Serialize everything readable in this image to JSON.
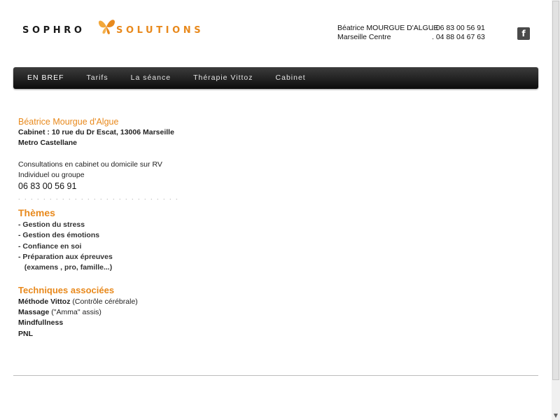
{
  "logo": {
    "left_word": "SOPHRO",
    "right_word": "SOLUTIONS",
    "accent_color": "#e8891c"
  },
  "contact": {
    "row1_name": "Béatrice MOURGUE D'ALGUE",
    "row1_phone": ".  06 83 00 56 91",
    "row2_name": "Marseille  Centre",
    "row2_phone": ".  04 88 04 67 63"
  },
  "social": {
    "facebook_icon": "facebook-icon",
    "facebook_glyph": "f"
  },
  "nav": {
    "items": [
      {
        "label": "EN BREF"
      },
      {
        "label": "Tarifs"
      },
      {
        "label": "La séance"
      },
      {
        "label": "Thérapie Vittoz"
      },
      {
        "label": "Cabinet"
      }
    ]
  },
  "intro": {
    "name": "Béatrice Mourgue d'Algue",
    "address": "Cabinet : 10 rue du Dr Escat, 13006 Marseille",
    "metro": "Metro Castellane",
    "consult": "Consultations en cabinet ou domicile sur RV",
    "mode": "Individuel ou groupe",
    "phone": "06 83 00 56 91",
    "dots": ". . . . . . . . . . . . . . . . . . . . . . . . . . . . . . . . . . ."
  },
  "themes": {
    "title": "Thèmes",
    "items": [
      "- Gestion du stress",
      "- Gestion des émotions",
      "- Confiance en soi",
      "- Préparation aux épreuves",
      "   (examens , pro, famille...)"
    ]
  },
  "techniques": {
    "title": "Techniques associées",
    "vittoz_bold": "Méthode Vittoz",
    "vittoz_rest": " (Contrôle cérébrale)",
    "massage_bold": "Massage",
    "massage_rest": " (\"Amma\" assis)",
    "mindfullness": "Mindfullness",
    "pnl": "PNL"
  }
}
